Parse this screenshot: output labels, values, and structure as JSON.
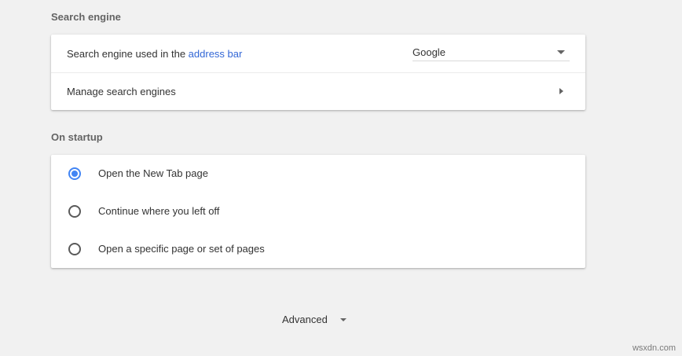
{
  "search_engine": {
    "section_title": "Search engine",
    "used_in_prefix": "Search engine used in the ",
    "used_in_link": "address bar",
    "selected_engine": "Google",
    "manage_label": "Manage search engines"
  },
  "on_startup": {
    "section_title": "On startup",
    "options": [
      {
        "label": "Open the New Tab page",
        "checked": true
      },
      {
        "label": "Continue where you left off",
        "checked": false
      },
      {
        "label": "Open a specific page or set of pages",
        "checked": false
      }
    ]
  },
  "advanced": {
    "label": "Advanced"
  },
  "watermark": "wsxdn.com",
  "colors": {
    "background": "#f1f1f1",
    "link": "#3367d6",
    "radio_checked": "#4285f4"
  }
}
